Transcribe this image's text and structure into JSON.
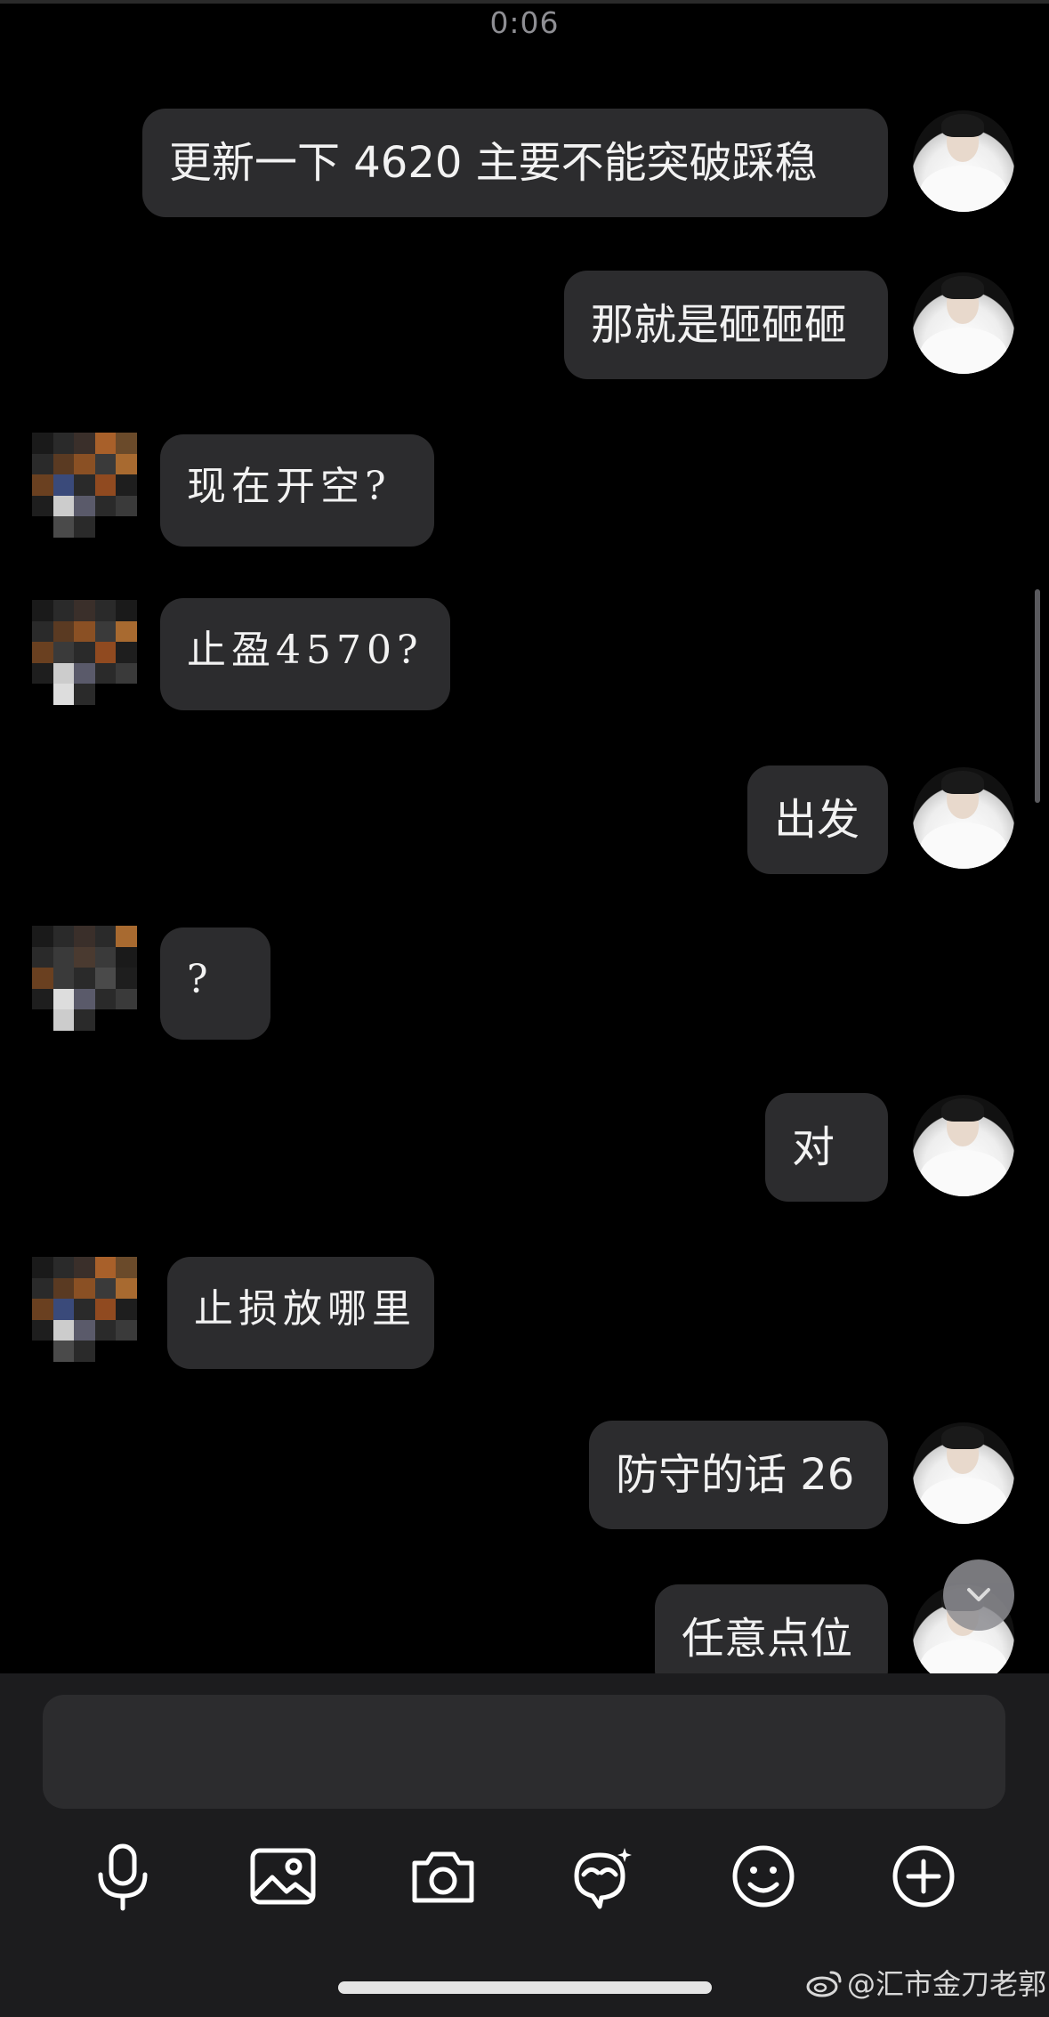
{
  "status": {
    "timestamp": "0:06"
  },
  "messages": [
    {
      "side": "me",
      "text": "更新一下 4620 主要不能突破踩稳"
    },
    {
      "side": "me",
      "text": "那就是砸砸砸"
    },
    {
      "side": "other",
      "text": "现在开空?"
    },
    {
      "side": "other",
      "text": "止盈4570?"
    },
    {
      "side": "me",
      "text": "出发"
    },
    {
      "side": "other",
      "text": "?"
    },
    {
      "side": "me",
      "text": "对"
    },
    {
      "side": "other",
      "text": "止损放哪里"
    },
    {
      "side": "me",
      "text": "防守的话 26"
    },
    {
      "side": "me",
      "text": "任意点位"
    }
  ],
  "composer": {
    "placeholder": ""
  },
  "toolbar": {
    "icons": [
      "microphone-icon",
      "image-icon",
      "camera-icon",
      "sticker-icon",
      "emoji-icon",
      "plus-icon"
    ]
  },
  "watermark": {
    "text": "@汇市金刀老郭"
  },
  "colors": {
    "background": "#000000",
    "bubble": "#2c2c2e",
    "text": "#f2f2f2",
    "toolbar_bg": "#1c1c1e",
    "timestamp": "#8e8e93"
  }
}
